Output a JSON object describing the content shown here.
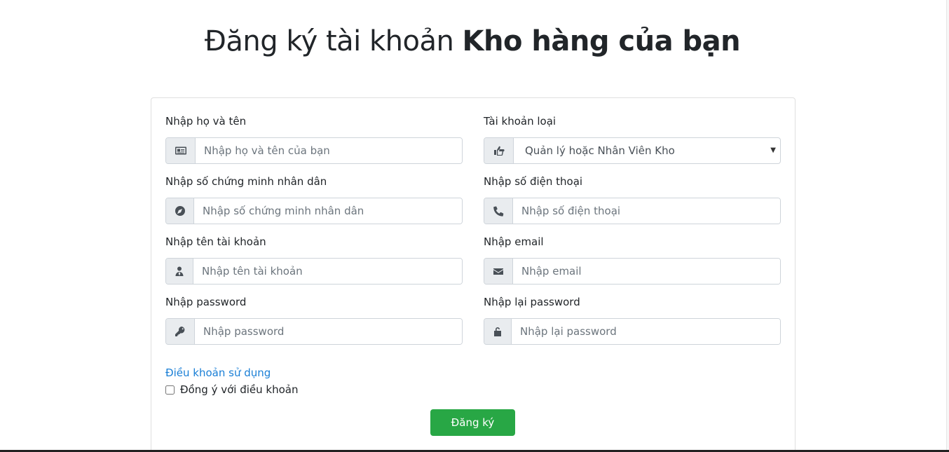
{
  "title": {
    "prefix": "Đăng ký tài khoản",
    "bold": "Kho hàng của bạn"
  },
  "form": {
    "fullname": {
      "label": "Nhập họ và tên",
      "placeholder": "Nhập họ và tên của bạn",
      "icon": "id-card-icon"
    },
    "account_type": {
      "label": "Tài khoản loại",
      "selected": "Quản lý hoặc Nhân Viên Kho",
      "icon": "hand-point-icon"
    },
    "id_number": {
      "label": "Nhập số chứng minh nhân dân",
      "placeholder": "Nhập số chứng minh nhân dân",
      "icon": "compass-icon"
    },
    "phone": {
      "label": "Nhập số điện thoại",
      "placeholder": "Nhập số điện thoại",
      "icon": "phone-icon"
    },
    "username": {
      "label": "Nhập tên tài khoản",
      "placeholder": "Nhập tên tài khoản",
      "icon": "user-tie-icon"
    },
    "email": {
      "label": "Nhập email",
      "placeholder": "Nhập email",
      "icon": "envelope-icon"
    },
    "password": {
      "label": "Nhập password",
      "placeholder": "Nhập password",
      "icon": "key-icon"
    },
    "password_confirm": {
      "label": "Nhập lại password",
      "placeholder": "Nhập lại password",
      "icon": "unlock-icon"
    },
    "terms_link": "Điều khoản sử dụng",
    "agree_label": "Đồng ý với điều khoản",
    "submit_label": "Đăng ký"
  },
  "colors": {
    "submit": "#28a745",
    "link": "#1a7fd6",
    "addon_bg": "#e9ecef"
  }
}
